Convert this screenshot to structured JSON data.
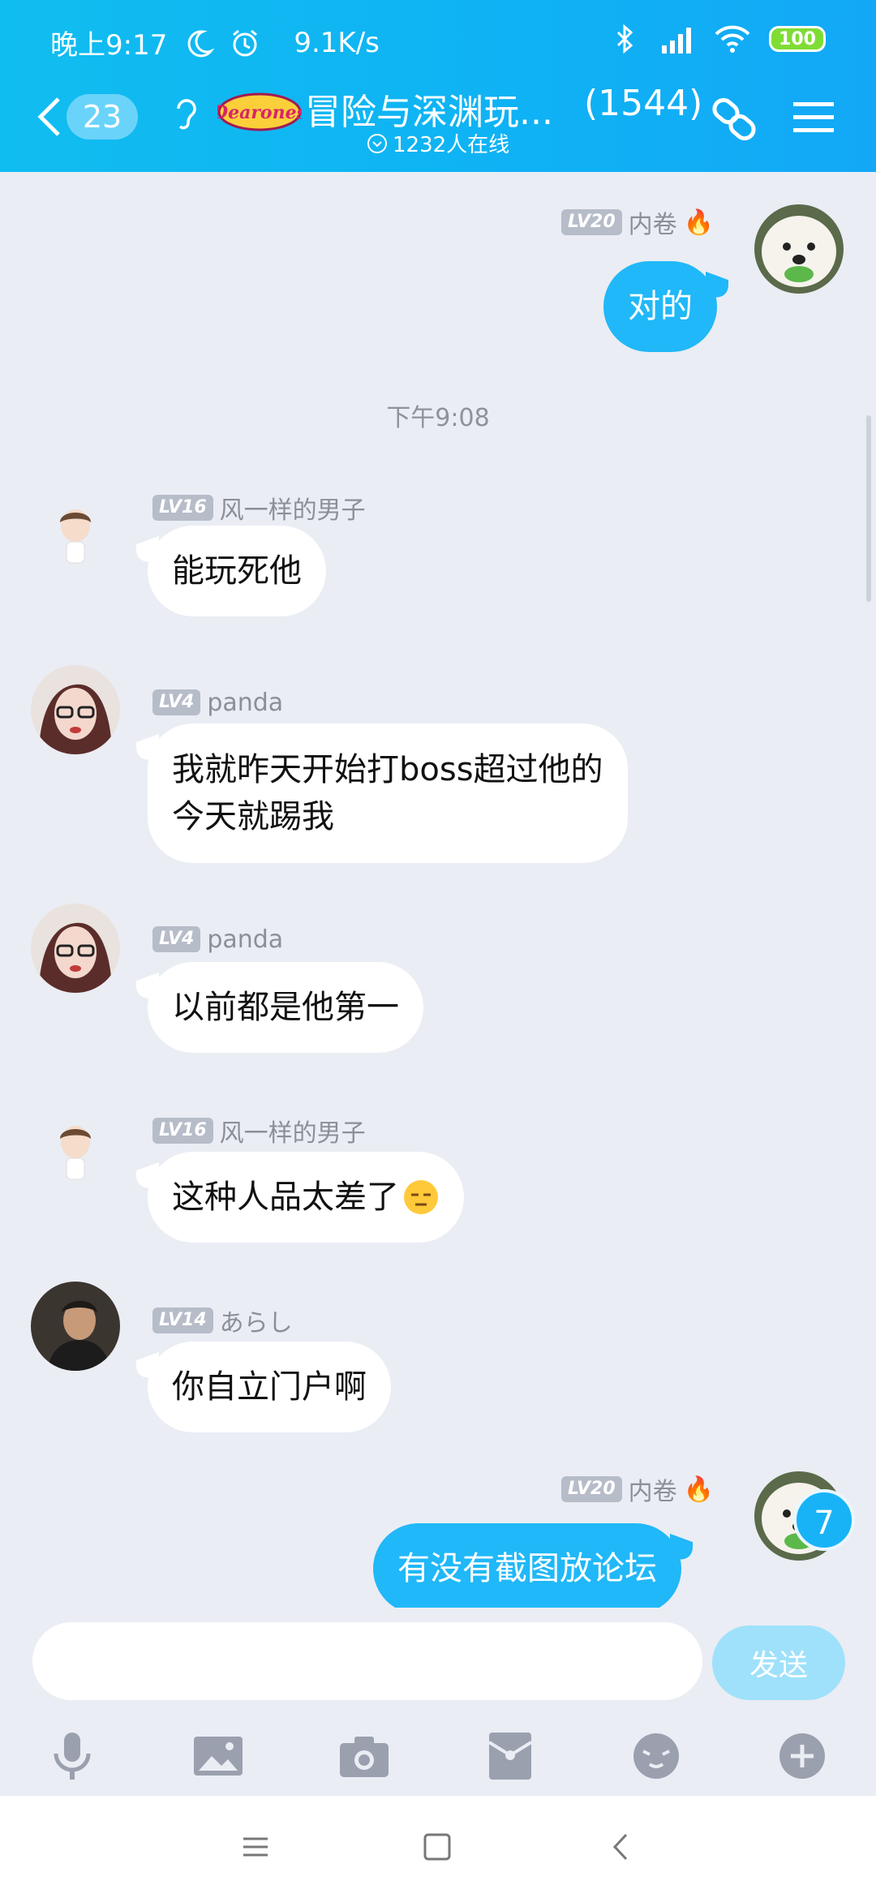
{
  "status": {
    "time": "晚上9:17",
    "net_speed": "9.1K/s",
    "battery": "100"
  },
  "header": {
    "back_count": "23",
    "group_logo_text": "Dearones",
    "title": "冒险与深渊玩...",
    "member_count": "(1544)",
    "online": "1232人在线"
  },
  "messages": [
    {
      "sender": "内卷",
      "level": "LV20",
      "text": "对的",
      "side": "right"
    },
    {
      "timestamp": "下午9:08"
    },
    {
      "sender": "风一样的男子",
      "level": "LV16",
      "text": "能玩死他",
      "side": "left"
    },
    {
      "sender": "panda",
      "level": "LV4",
      "text_line1": "我就昨天开始打boss超过他的",
      "text_line2": "今天就踢我",
      "side": "left"
    },
    {
      "sender": "panda",
      "level": "LV4",
      "text": "以前都是他第一",
      "side": "left"
    },
    {
      "sender": "风一样的男子",
      "level": "LV16",
      "text": "这种人品太差了",
      "side": "left"
    },
    {
      "sender": "あらし",
      "level": "LV14",
      "text": "你自立门户啊",
      "side": "left"
    },
    {
      "sender": "内卷",
      "level": "LV20",
      "text": "有没有截图放论坛",
      "side": "right"
    }
  ],
  "new_message_badge": "7",
  "input": {
    "value": "",
    "placeholder": "",
    "send_label": "发送"
  },
  "toolbar_icons": [
    "microphone-icon",
    "image-icon",
    "camera-icon",
    "red-packet-icon",
    "emoji-icon",
    "plus-icon"
  ],
  "colors": {
    "header_gradient_start": "#10bdf0",
    "header_gradient_end": "#13a8f6",
    "my_bubble": "#20b8f8",
    "other_bubble": "#ffffff",
    "chat_background": "#eaedf4",
    "send_button": "#9fe1fb",
    "battery": "#7fdc35"
  }
}
